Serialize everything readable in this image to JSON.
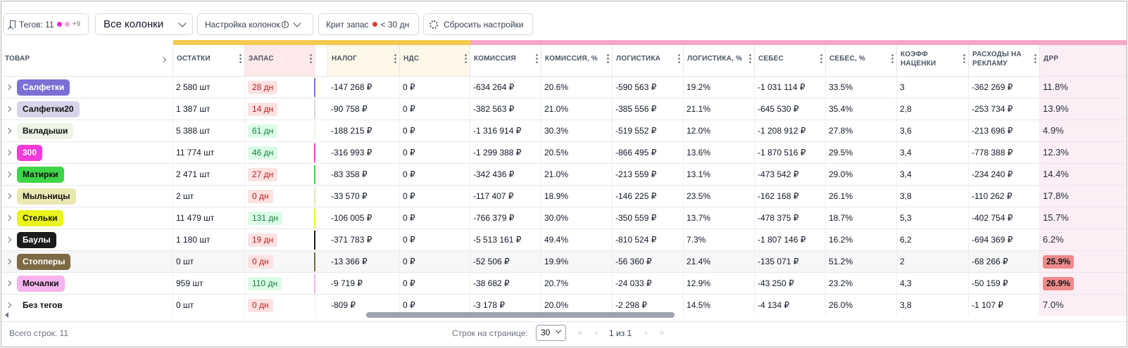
{
  "toolbar": {
    "tags_label": "Тегов: 11",
    "tags_more": "+9",
    "tag_dot_colors": [
      "#e62ccf",
      "#f5a6d8"
    ],
    "columns_select": "Все колонки",
    "columns_settings": "Настройка колонок",
    "crit_prefix": "Крит запас",
    "crit_suffix": "< 30 дн",
    "reset": "Сбросить настройки"
  },
  "columns": {
    "product": "Товар",
    "ostatki": "Остатки",
    "zapas": "Запас",
    "nalog": "Налог",
    "nds": "НДС",
    "komissiya": "Комиссия",
    "komissiya_pct": "Комиссия, %",
    "logistika": "Логистика",
    "logistika_pct": "Логистика, %",
    "sebes": "Себес",
    "sebes_pct": "Себес, %",
    "koeff": "Коэфф наценки",
    "rashody": "Расходы на рекламу",
    "drr": "ДРР"
  },
  "rows": [
    {
      "name": "Салфетки",
      "tag_color": "#7b6fd6",
      "text_color": "#ffffff",
      "stock": "2 580 шт",
      "zapas": "28 дн",
      "zapas_state": "red",
      "nalog": "-147 268 ₽",
      "nds": "0 ₽",
      "kom": "-634 264 ₽",
      "kom_pct": "20.6%",
      "log": "-590 563 ₽",
      "log_pct": "19.2%",
      "seb": "-1 031 114 ₽",
      "seb_pct": "33.5%",
      "koeff": "3",
      "ads": "-362 269 ₽",
      "drr": "11.8%",
      "drr_hi": false
    },
    {
      "name": "Салфетки20",
      "tag_color": "#d7d4e9",
      "text_color": "#111111",
      "stock": "1 387 шт",
      "zapas": "14 дн",
      "zapas_state": "red",
      "nalog": "-90 758 ₽",
      "nds": "0 ₽",
      "kom": "-382 563 ₽",
      "kom_pct": "21.0%",
      "log": "-385 556 ₽",
      "log_pct": "21.1%",
      "seb": "-645 530 ₽",
      "seb_pct": "35.4%",
      "koeff": "2,8",
      "ads": "-253 734 ₽",
      "drr": "13.9%",
      "drr_hi": false
    },
    {
      "name": "Вкладыши",
      "tag_color": "#eef5e6",
      "text_color": "#111111",
      "stock": "5 388 шт",
      "zapas": "61 дн",
      "zapas_state": "green",
      "nalog": "-188 215 ₽",
      "nds": "0 ₽",
      "kom": "-1 316 914 ₽",
      "kom_pct": "30.3%",
      "log": "-519 552 ₽",
      "log_pct": "12.0%",
      "seb": "-1 208 912 ₽",
      "seb_pct": "27.8%",
      "koeff": "3,6",
      "ads": "-213 696 ₽",
      "drr": "4.9%",
      "drr_hi": false
    },
    {
      "name": "300",
      "tag_color": "#f03cd8",
      "text_color": "#ffffff",
      "stock": "11 774 шт",
      "zapas": "46 дн",
      "zapas_state": "green",
      "nalog": "-316 993 ₽",
      "nds": "0 ₽",
      "kom": "-1 299 388 ₽",
      "kom_pct": "20.5%",
      "log": "-866 495 ₽",
      "log_pct": "13.6%",
      "seb": "-1 870 516 ₽",
      "seb_pct": "29.5%",
      "koeff": "3,4",
      "ads": "-778 388 ₽",
      "drr": "12.3%",
      "drr_hi": false
    },
    {
      "name": "Матирки",
      "tag_color": "#3fd548",
      "text_color": "#111111",
      "stock": "2 471 шт",
      "zapas": "27 дн",
      "zapas_state": "red",
      "nalog": "-83 358 ₽",
      "nds": "0 ₽",
      "kom": "-342 436 ₽",
      "kom_pct": "21.0%",
      "log": "-213 559 ₽",
      "log_pct": "13.1%",
      "seb": "-473 542 ₽",
      "seb_pct": "29.0%",
      "koeff": "3,4",
      "ads": "-234 240 ₽",
      "drr": "14.4%",
      "drr_hi": false
    },
    {
      "name": "Мыльницы",
      "tag_color": "#eae7b1",
      "text_color": "#111111",
      "stock": "2 шт",
      "zapas": "0 дн",
      "zapas_state": "red",
      "nalog": "-33 570 ₽",
      "nds": "0 ₽",
      "kom": "-117 407 ₽",
      "kom_pct": "18.9%",
      "log": "-146 225 ₽",
      "log_pct": "23.5%",
      "seb": "-162 168 ₽",
      "seb_pct": "26.1%",
      "koeff": "3,8",
      "ads": "-110 262 ₽",
      "drr": "17.8%",
      "drr_hi": false
    },
    {
      "name": "Стельки",
      "tag_color": "#e8f41c",
      "text_color": "#111111",
      "stock": "11 479 шт",
      "zapas": "131 дн",
      "zapas_state": "green",
      "nalog": "-106 005 ₽",
      "nds": "0 ₽",
      "kom": "-766 379 ₽",
      "kom_pct": "30.0%",
      "log": "-350 559 ₽",
      "log_pct": "13.7%",
      "seb": "-478 375 ₽",
      "seb_pct": "18.7%",
      "koeff": "5,3",
      "ads": "-402 754 ₽",
      "drr": "15.7%",
      "drr_hi": false
    },
    {
      "name": "Баулы",
      "tag_color": "#1c1c1c",
      "text_color": "#ffffff",
      "stock": "1 180 шт",
      "zapas": "19 дн",
      "zapas_state": "red",
      "nalog": "-371 783 ₽",
      "nds": "0 ₽",
      "kom": "-5 513 161 ₽",
      "kom_pct": "49.4%",
      "log": "-810 524 ₽",
      "log_pct": "7.3%",
      "seb": "-1 807 146 ₽",
      "seb_pct": "16.2%",
      "koeff": "6,2",
      "ads": "-694 369 ₽",
      "drr": "6.2%",
      "drr_hi": false
    },
    {
      "name": "Стопперы",
      "tag_color": "#7d6a45",
      "text_color": "#ffffff",
      "stock": "0 шт",
      "zapas": "0 дн",
      "zapas_state": "red",
      "nalog": "-13 366 ₽",
      "nds": "0 ₽",
      "kom": "-52 506 ₽",
      "kom_pct": "19.9%",
      "log": "-56 360 ₽",
      "log_pct": "21.4%",
      "seb": "-135 071 ₽",
      "seb_pct": "51.2%",
      "koeff": "2",
      "ads": "-68 266 ₽",
      "drr": "25.9%",
      "drr_hi": true
    },
    {
      "name": "Мочалки",
      "tag_color": "#f7b3ee",
      "text_color": "#111111",
      "stock": "959 шт",
      "zapas": "110 дн",
      "zapas_state": "green",
      "nalog": "-9 719 ₽",
      "nds": "0 ₽",
      "kom": "-38 682 ₽",
      "kom_pct": "20.7%",
      "log": "-24 033 ₽",
      "log_pct": "12.9%",
      "seb": "-43 250 ₽",
      "seb_pct": "23.2%",
      "koeff": "4,3",
      "ads": "-50 159 ₽",
      "drr": "26.9%",
      "drr_hi": true
    },
    {
      "name": "Без тегов",
      "tag_color": "",
      "text_color": "#111111",
      "stock": "0 шт",
      "zapas": "0 дн",
      "zapas_state": "red",
      "nalog": "-809 ₽",
      "nds": "0 ₽",
      "kom": "-3 178 ₽",
      "kom_pct": "20.0%",
      "log": "-2 298 ₽",
      "log_pct": "14.5%",
      "seb": "-4 134 ₽",
      "seb_pct": "26.0%",
      "koeff": "3,8",
      "ads": "-1 107 ₽",
      "drr": "7.0%",
      "drr_hi": false
    }
  ],
  "footer": {
    "total": "Всего строк: 11",
    "rows_per_page_label": "Строк на странице:",
    "rows_per_page": "30",
    "page_info": "1 из 1"
  },
  "colors": {
    "stock_band": "#f5c94e",
    "finance_band": "#f6a7c9",
    "zapas_tint": "#fde8ea",
    "nalog_tint": "#fff8e8",
    "drr_tint": "#fdeef5"
  }
}
